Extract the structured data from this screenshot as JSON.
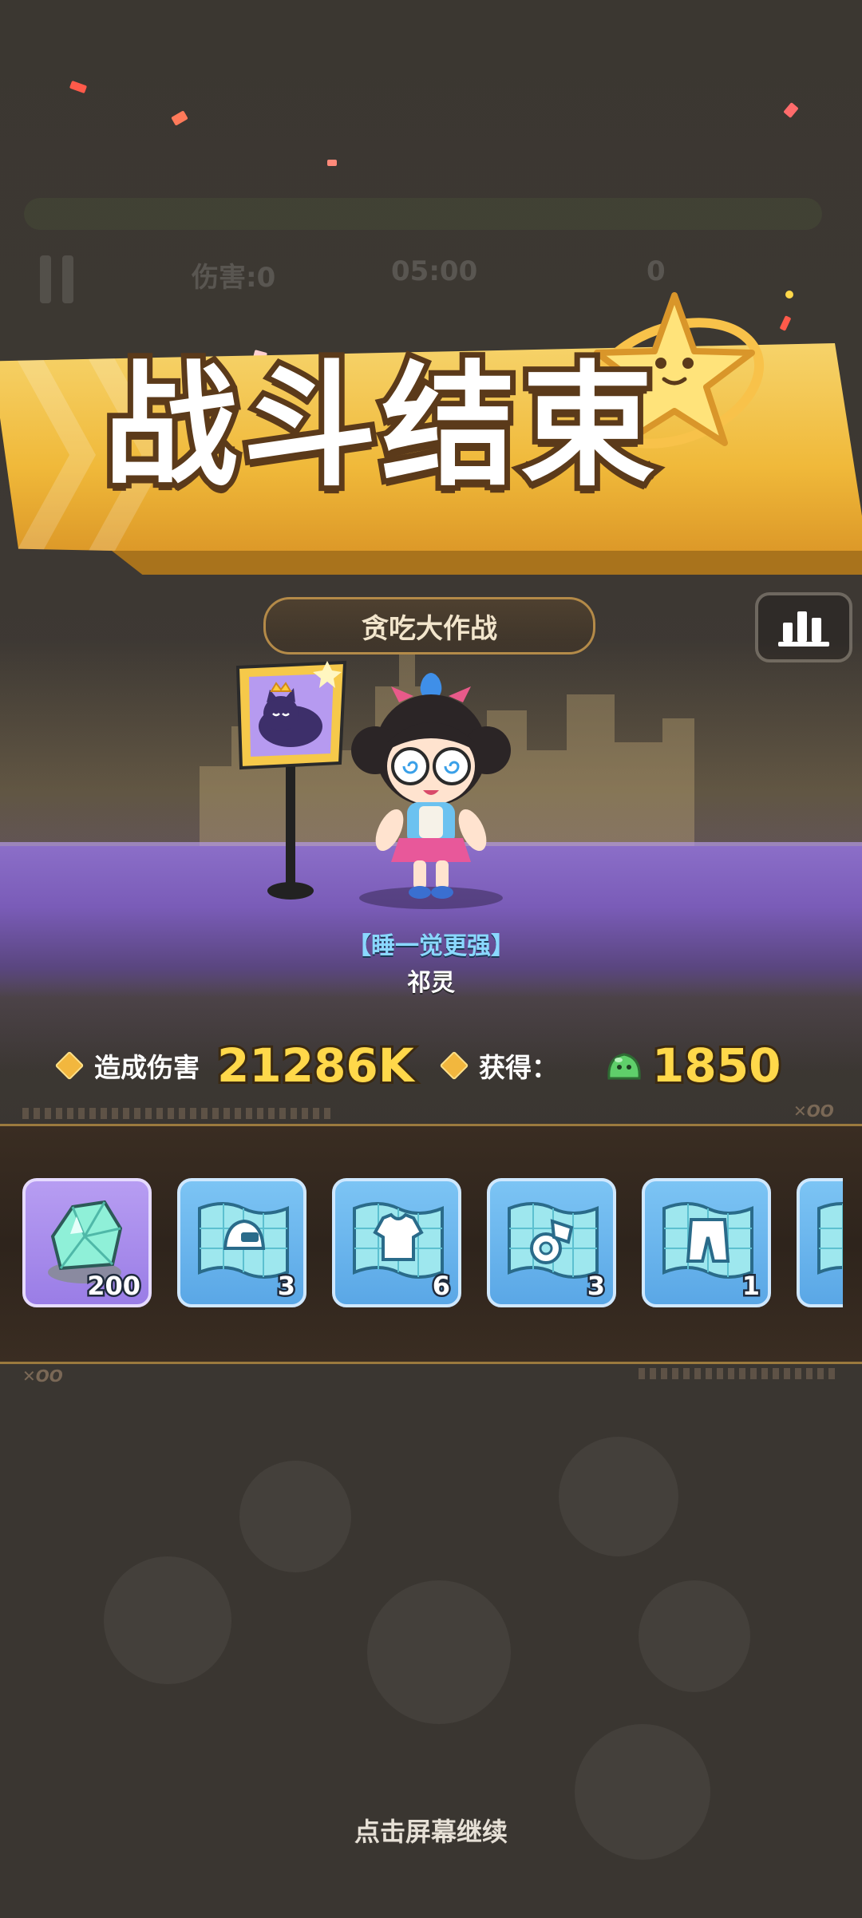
{
  "background_hud": {
    "damage": "伤害:0",
    "timer": "05:00",
    "count": "0"
  },
  "banner": {
    "title": "战斗结束"
  },
  "mode": {
    "title": "贪吃大作战",
    "stats_icon": "bar-chart-icon"
  },
  "character": {
    "title": "【睡一觉更强】",
    "name": "祁灵",
    "flag_icon": "sleeping-cat-crown-icon"
  },
  "stats": {
    "damage_label": "造成伤害",
    "damage_value": "21286K",
    "gain_label": "获得：",
    "gain_icon": "green-slime-icon",
    "gain_value": "1850"
  },
  "rewards": {
    "items": [
      {
        "icon": "crystal-icon",
        "quantity": "200",
        "color": "#a88cf0"
      },
      {
        "icon": "blueprint-helmet-icon",
        "quantity": "3",
        "color": "#6ab6ee"
      },
      {
        "icon": "blueprint-armor-icon",
        "quantity": "6",
        "color": "#6ab6ee"
      },
      {
        "icon": "blueprint-boots-icon",
        "quantity": "3",
        "color": "#6ab6ee"
      },
      {
        "icon": "blueprint-pants-icon",
        "quantity": "1",
        "color": "#6ab6ee"
      },
      {
        "icon": "blueprint-icon",
        "quantity": "",
        "color": "#6ab6ee"
      }
    ]
  },
  "footer": {
    "continue_text": "点击屏幕继续"
  },
  "colors": {
    "gold": "#f0b93a",
    "value_yellow": "#ffd84a",
    "title_blue": "#8ad8ff"
  }
}
